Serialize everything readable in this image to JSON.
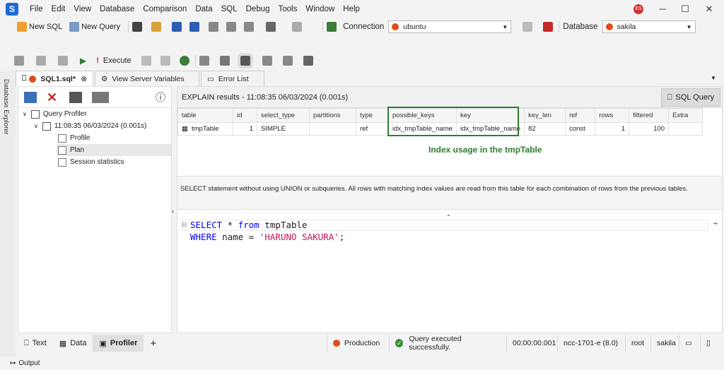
{
  "menu": [
    "File",
    "Edit",
    "View",
    "Database",
    "Comparison",
    "Data",
    "SQL",
    "Debug",
    "Tools",
    "Window",
    "Help"
  ],
  "user_initials": "ES",
  "toolbar1": {
    "new_sql": "New SQL",
    "new_query": "New Query",
    "connection_label": "Connection",
    "connection_value": "ubuntu",
    "database_label": "Database",
    "database_value": "sakila"
  },
  "toolbar2": {
    "execute_label": "Execute"
  },
  "doc_tabs": {
    "sql1": "SQL1.sql*",
    "server_vars": "View Server Variables",
    "error_list": "Error List"
  },
  "sidebar_vertical": "Database Explorer",
  "tree": {
    "root": "Query Profiler",
    "session": "11:08:35 06/03/2024 (0.001s)",
    "profile": "Profile",
    "plan": "Plan",
    "stats": "Session statistics"
  },
  "results": {
    "header": "EXPLAIN results - 11:08:35 06/03/2024 (0.001s)",
    "sql_query_btn": "SQL Query",
    "columns": [
      "table",
      "id",
      "select_type",
      "partitions",
      "type",
      "possible_keys",
      "key",
      "key_len",
      "ref",
      "rows",
      "filtered",
      "Extra"
    ],
    "row": {
      "table": "tmpTable",
      "id": "1",
      "select_type": "SIMPLE",
      "partitions": "",
      "type": "ref",
      "possible_keys": "idx_tmpTable_name",
      "key": "idx_tmpTable_name",
      "key_len": "82",
      "ref": "const",
      "rows": "1",
      "filtered": "100",
      "extra": ""
    },
    "annotation": "Index usage in the tmpTable",
    "description": "SELECT statement without using UNION or subqueries. All rows with matching index values are read from this table for each combination of rows from the previous tables."
  },
  "editor": {
    "l1_kw1": "SELECT",
    "l1_op": " * ",
    "l1_kw2": "from",
    "l1_rest": " tmpTable",
    "l2_kw": "WHERE",
    "l2_mid": " name = ",
    "l2_str": "'HARUNO SAKURA'",
    "l2_end": ";"
  },
  "bottom_tabs": {
    "text": "Text",
    "data": "Data",
    "profiler": "Profiler",
    "add": "+"
  },
  "status": {
    "env": "Production",
    "message": "Query executed successfully.",
    "time": "00:00:00.001",
    "server": "ncc-1701-e (8.0)",
    "user": "root",
    "db": "sakila"
  },
  "output": "Output",
  "colors": {
    "highlight": "#2e7d32",
    "keyword": "#0000ff",
    "string": "#c2185b"
  }
}
